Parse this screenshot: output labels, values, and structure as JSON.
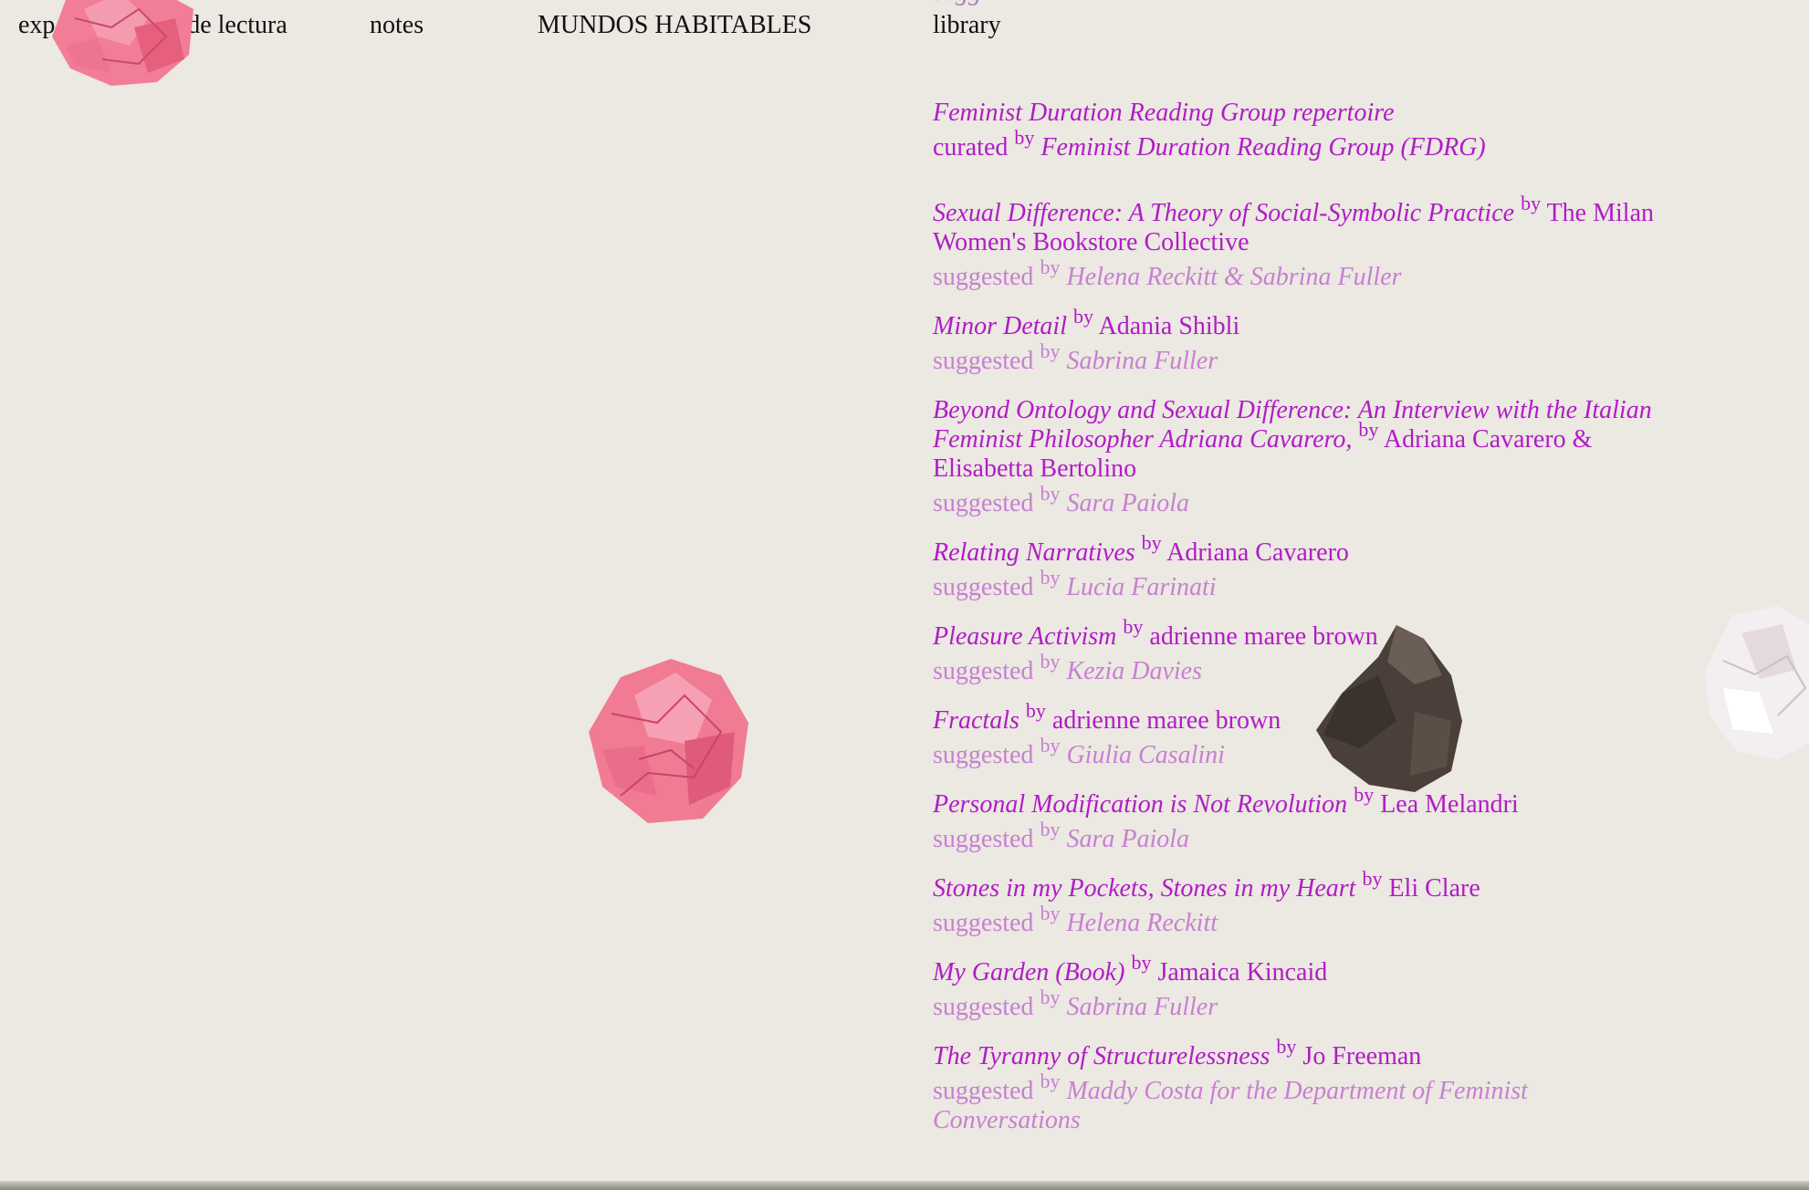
{
  "nav": {
    "item1": "exp",
    "item2": "guía de lectura",
    "item3": "notes",
    "item4": "MUNDOS HABITABLES",
    "item5": "library"
  },
  "top_fragment": "sugg",
  "curated": {
    "title": "Feminist Duration Reading Group repertoire",
    "prefix": "curated",
    "by": "by",
    "group": "Feminist Duration Reading Group (FDRG)"
  },
  "suggested_word": "suggested",
  "by_word": "by",
  "entries": [
    {
      "title": "Sexual Difference: A Theory of Social-Symbolic Practice",
      "author": "The Milan Women's Bookstore Collective",
      "suggested_by": "Helena Reckitt & Sabrina Fuller"
    },
    {
      "title": "Minor Detail",
      "author": "Adania Shibli",
      "suggested_by": "Sabrina Fuller"
    },
    {
      "title": "Beyond Ontology and Sexual Difference: An Interview with the Italian Feminist Philosopher Adriana Cavarero,",
      "author": "Adriana Cavarero & Elisabetta Bertolino",
      "suggested_by": "Sara Paiola"
    },
    {
      "title": "Relating Narratives",
      "author": "Adriana Cavarero",
      "suggested_by": "Lucia Farinati"
    },
    {
      "title": "Pleasure Activism",
      "author": "adrienne maree brown",
      "suggested_by": "Kezia Davies"
    },
    {
      "title": "Fractals",
      "author": "adrienne maree brown",
      "suggested_by": "Giulia Casalini"
    },
    {
      "title": "Personal Modification is Not Revolution",
      "author": "Lea Melandri",
      "suggested_by": "Sara Paiola"
    },
    {
      "title": "Stones in my Pockets, Stones in my Heart",
      "author": "Eli Clare",
      "suggested_by": "Helena Reckitt"
    },
    {
      "title": "My Garden (Book)",
      "author": "Jamaica Kincaid",
      "suggested_by": "Sabrina Fuller"
    },
    {
      "title": "The Tyranny of Structurelessness",
      "author": "Jo Freeman",
      "suggested_by": "Maddy Costa for the Department of Feminist Conversations"
    }
  ],
  "colors": {
    "background": "#ece8e2",
    "title": "#b01cc6",
    "suggested": "#c780d1",
    "paper_pink": "#f07b93",
    "rock": "#4a4039"
  },
  "decorations": {
    "paper_ball_top": "crumpled-pink-paper-icon",
    "paper_ball_middle": "crumpled-pink-paper-icon",
    "rock": "rock-icon",
    "paper_ball_right": "crumpled-white-paper-icon"
  }
}
